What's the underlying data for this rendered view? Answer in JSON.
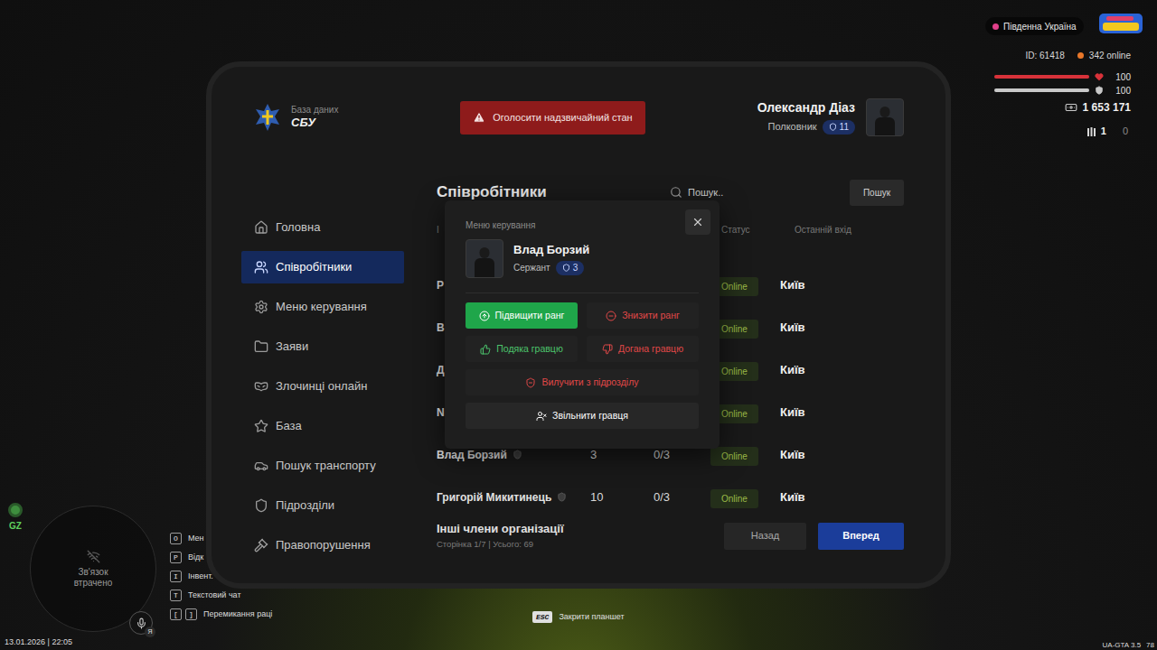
{
  "app": {
    "logo_caption": "База даних",
    "logo_title": "СБУ"
  },
  "emergency_button": "Оголосити надзвичайний стан",
  "user": {
    "name": "Олександр Діаз",
    "rank": "Полковник",
    "level": "11"
  },
  "sidebar": {
    "items": [
      {
        "label": "Головна",
        "selected": false
      },
      {
        "label": "Співробітники",
        "selected": true
      },
      {
        "label": "Меню керування",
        "selected": false
      },
      {
        "label": "Заяви",
        "selected": false
      },
      {
        "label": "Злочинці онлайн",
        "selected": false
      },
      {
        "label": "База",
        "selected": false
      },
      {
        "label": "Пошук транспорту",
        "selected": false
      },
      {
        "label": "Підрозділи",
        "selected": false
      },
      {
        "label": "Правопорушення",
        "selected": false
      }
    ]
  },
  "page": {
    "title": "Співробітники",
    "search": {
      "placeholder": "Пошук.."
    },
    "search_button": "Пошук"
  },
  "table": {
    "columns": {
      "name": "І",
      "status": "Статус",
      "last_login": "Останній вхід"
    },
    "rows": [
      {
        "name": "Р",
        "status": "Online",
        "city": "Київ"
      },
      {
        "name": "В",
        "status": "Online",
        "city": "Київ"
      },
      {
        "name": "Д",
        "status": "Online",
        "city": "Київ"
      },
      {
        "name": "N",
        "status": "Online",
        "city": "Київ"
      },
      {
        "name": "Влад Борзий",
        "rank": "3",
        "warns": "0/3",
        "status": "Online",
        "city": "Київ"
      },
      {
        "name": "Григорій Микитинець",
        "rank": "10",
        "warns": "0/3",
        "status": "Online",
        "city": "Київ"
      }
    ]
  },
  "footer": {
    "title": "Інші члени організації",
    "info": "Сторінка 1/7 | Усього: 69",
    "buttons": [
      {
        "label": "Назад",
        "primary": false
      },
      {
        "label": "Вперед",
        "primary": true
      }
    ]
  },
  "modal": {
    "title": "Меню керування",
    "member": {
      "name": "Влад Борзий",
      "rank": "Сержант",
      "level": "3"
    },
    "actions": [
      {
        "label": "Підвищити ранг",
        "kind": "filled",
        "color": "#1fa64a"
      },
      {
        "label": "Знизити ранг",
        "kind": "text",
        "color": "#e04848"
      },
      {
        "label": "Подяка гравцю",
        "kind": "text",
        "color": "#4cc46c"
      },
      {
        "label": "Догана гравцю",
        "kind": "text",
        "color": "#e04848"
      },
      {
        "label": "Вилучити з підрозділу",
        "kind": "text",
        "color": "#e04848"
      },
      {
        "label": "Звільнити гравця",
        "kind": "text",
        "color": "#ffffff"
      }
    ]
  },
  "hud": {
    "region": "Південна Україна",
    "id": "ID: 61418",
    "online": "342 online",
    "health": {
      "level": 1,
      "value": "100"
    },
    "armor": {
      "level": 1,
      "value": "100"
    },
    "money": "1 653 171",
    "ammo": {
      "clip": "1",
      "reserve": "0"
    }
  },
  "minimap": {
    "status": "Зв'язок втрачено",
    "zone": "GZ"
  },
  "voice": {
    "badge": "Я"
  },
  "hints": [
    {
      "keys": [
        "O"
      ],
      "label": "Мен"
    },
    {
      "keys": [
        "P"
      ],
      "label": "Відк"
    },
    {
      "keys": [
        "I"
      ],
      "label": "Інвент."
    },
    {
      "keys": [
        "T"
      ],
      "label": "Текстовий чат"
    },
    {
      "keys": [
        "[",
        "]"
      ],
      "label": "Перемикання раці"
    }
  ],
  "datetime": "13.01.2026 | 22:05",
  "close_hint": {
    "key": "ESC",
    "label": "Закрити планшет"
  },
  "version": {
    "label": "UA-GTA 3.5",
    "extra": "78"
  }
}
